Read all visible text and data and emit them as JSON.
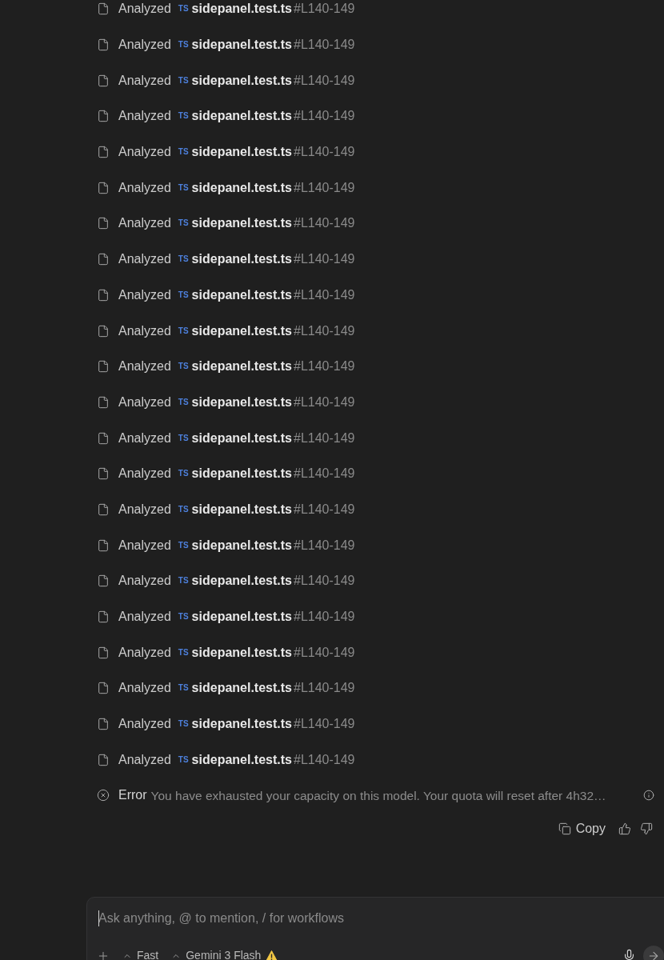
{
  "activity": [
    {
      "status": "Analyzed",
      "badge": "TS",
      "file": "sidepanel.test.ts",
      "anchor": "#L140-149"
    },
    {
      "status": "Analyzed",
      "badge": "TS",
      "file": "sidepanel.test.ts",
      "anchor": "#L140-149"
    },
    {
      "status": "Analyzed",
      "badge": "TS",
      "file": "sidepanel.test.ts",
      "anchor": "#L140-149"
    },
    {
      "status": "Analyzed",
      "badge": "TS",
      "file": "sidepanel.test.ts",
      "anchor": "#L140-149"
    },
    {
      "status": "Analyzed",
      "badge": "TS",
      "file": "sidepanel.test.ts",
      "anchor": "#L140-149"
    },
    {
      "status": "Analyzed",
      "badge": "TS",
      "file": "sidepanel.test.ts",
      "anchor": "#L140-149"
    },
    {
      "status": "Analyzed",
      "badge": "TS",
      "file": "sidepanel.test.ts",
      "anchor": "#L140-149"
    },
    {
      "status": "Analyzed",
      "badge": "TS",
      "file": "sidepanel.test.ts",
      "anchor": "#L140-149"
    },
    {
      "status": "Analyzed",
      "badge": "TS",
      "file": "sidepanel.test.ts",
      "anchor": "#L140-149"
    },
    {
      "status": "Analyzed",
      "badge": "TS",
      "file": "sidepanel.test.ts",
      "anchor": "#L140-149"
    },
    {
      "status": "Analyzed",
      "badge": "TS",
      "file": "sidepanel.test.ts",
      "anchor": "#L140-149"
    },
    {
      "status": "Analyzed",
      "badge": "TS",
      "file": "sidepanel.test.ts",
      "anchor": "#L140-149"
    },
    {
      "status": "Analyzed",
      "badge": "TS",
      "file": "sidepanel.test.ts",
      "anchor": "#L140-149"
    },
    {
      "status": "Analyzed",
      "badge": "TS",
      "file": "sidepanel.test.ts",
      "anchor": "#L140-149"
    },
    {
      "status": "Analyzed",
      "badge": "TS",
      "file": "sidepanel.test.ts",
      "anchor": "#L140-149"
    },
    {
      "status": "Analyzed",
      "badge": "TS",
      "file": "sidepanel.test.ts",
      "anchor": "#L140-149"
    },
    {
      "status": "Analyzed",
      "badge": "TS",
      "file": "sidepanel.test.ts",
      "anchor": "#L140-149"
    },
    {
      "status": "Analyzed",
      "badge": "TS",
      "file": "sidepanel.test.ts",
      "anchor": "#L140-149"
    },
    {
      "status": "Analyzed",
      "badge": "TS",
      "file": "sidepanel.test.ts",
      "anchor": "#L140-149"
    },
    {
      "status": "Analyzed",
      "badge": "TS",
      "file": "sidepanel.test.ts",
      "anchor": "#L140-149"
    },
    {
      "status": "Analyzed",
      "badge": "TS",
      "file": "sidepanel.test.ts",
      "anchor": "#L140-149"
    },
    {
      "status": "Analyzed",
      "badge": "TS",
      "file": "sidepanel.test.ts",
      "anchor": "#L140-149"
    }
  ],
  "error": {
    "label": "Error",
    "message": "You have exhausted your capacity on this model. Your quota will reset after 4h32…"
  },
  "actions": {
    "copy": "Copy"
  },
  "composer": {
    "placeholder": "Ask anything, @ to mention, / for workflows",
    "mode": "Fast",
    "model": "Gemini 3 Flash",
    "model_warning": true
  }
}
